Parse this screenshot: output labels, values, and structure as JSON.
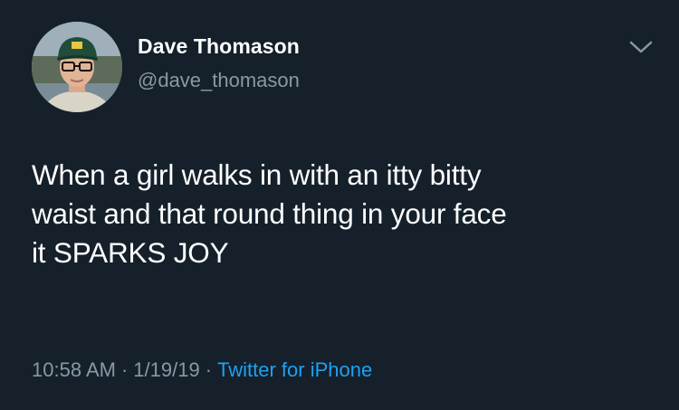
{
  "author": {
    "name": "Dave Thomason",
    "handle": "@dave_thomason",
    "avatar_icon": "profile-photo"
  },
  "tweet": {
    "lines": [
      "When a girl walks in with an itty bitty",
      "waist and that round thing in your face",
      "it SPARKS JOY"
    ]
  },
  "meta": {
    "time": "10:58 AM",
    "separator": "·",
    "date": "1/19/19",
    "source": "Twitter for iPhone"
  },
  "icons": {
    "menu": "chevron-down-icon"
  },
  "colors": {
    "background": "#15202b",
    "text": "#ffffff",
    "secondary_text": "#8899a6",
    "link": "#1da1f2"
  }
}
